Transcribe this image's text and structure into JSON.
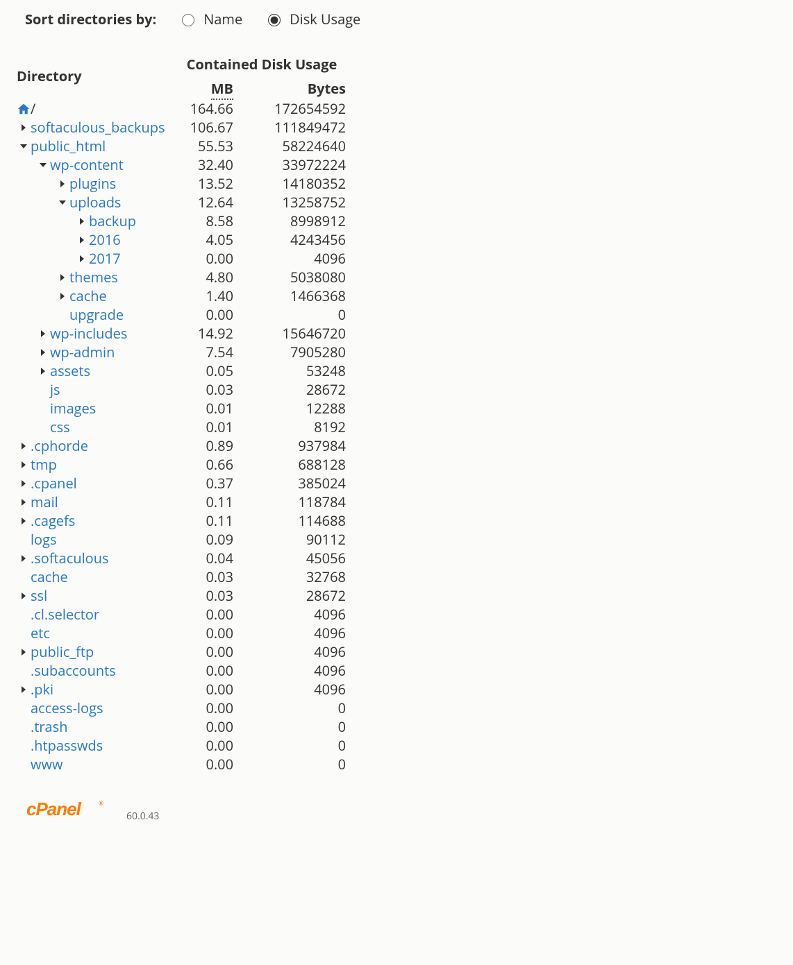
{
  "sort": {
    "label": "Sort directories by:",
    "options": {
      "name": "Name",
      "usage": "Disk Usage"
    },
    "selected": "usage"
  },
  "headers": {
    "directory": "Directory",
    "containedUsage": "Contained Disk Usage",
    "mb": "MB",
    "bytes": "Bytes"
  },
  "rows": [
    {
      "type": "home",
      "indent": 1,
      "mb": "164.66",
      "bytes": "172654592"
    },
    {
      "name": "softaculous_backups",
      "indent": 1,
      "toggle": "closed",
      "mb": "106.67",
      "bytes": "111849472"
    },
    {
      "name": "public_html",
      "indent": 1,
      "toggle": "open",
      "mb": "55.53",
      "bytes": "58224640"
    },
    {
      "name": "wp-content",
      "indent": 2,
      "toggle": "open",
      "mb": "32.40",
      "bytes": "33972224"
    },
    {
      "name": "plugins",
      "indent": 3,
      "toggle": "closed",
      "mb": "13.52",
      "bytes": "14180352"
    },
    {
      "name": "uploads",
      "indent": 3,
      "toggle": "open",
      "mb": "12.64",
      "bytes": "13258752"
    },
    {
      "name": "backup",
      "indent": 4,
      "toggle": "closed",
      "mb": "8.58",
      "bytes": "8998912"
    },
    {
      "name": "2016",
      "indent": 4,
      "toggle": "closed",
      "mb": "4.05",
      "bytes": "4243456"
    },
    {
      "name": "2017",
      "indent": 4,
      "toggle": "closed",
      "mb": "0.00",
      "bytes": "4096"
    },
    {
      "name": "themes",
      "indent": 3,
      "toggle": "closed",
      "mb": "4.80",
      "bytes": "5038080"
    },
    {
      "name": "cache",
      "indent": 3,
      "toggle": "closed",
      "mb": "1.40",
      "bytes": "1466368"
    },
    {
      "name": "upgrade",
      "indent": 3,
      "toggle": "none",
      "mb": "0.00",
      "bytes": "0"
    },
    {
      "name": "wp-includes",
      "indent": 2,
      "toggle": "closed",
      "mb": "14.92",
      "bytes": "15646720"
    },
    {
      "name": "wp-admin",
      "indent": 2,
      "toggle": "closed",
      "mb": "7.54",
      "bytes": "7905280"
    },
    {
      "name": "assets",
      "indent": 2,
      "toggle": "closed",
      "mb": "0.05",
      "bytes": "53248"
    },
    {
      "name": "js",
      "indent": 2,
      "toggle": "none",
      "mb": "0.03",
      "bytes": "28672"
    },
    {
      "name": "images",
      "indent": 2,
      "toggle": "none",
      "mb": "0.01",
      "bytes": "12288"
    },
    {
      "name": "css",
      "indent": 2,
      "toggle": "none",
      "mb": "0.01",
      "bytes": "8192"
    },
    {
      "name": ".cphorde",
      "indent": 1,
      "toggle": "closed",
      "mb": "0.89",
      "bytes": "937984"
    },
    {
      "name": "tmp",
      "indent": 1,
      "toggle": "closed",
      "mb": "0.66",
      "bytes": "688128"
    },
    {
      "name": ".cpanel",
      "indent": 1,
      "toggle": "closed",
      "mb": "0.37",
      "bytes": "385024"
    },
    {
      "name": "mail",
      "indent": 1,
      "toggle": "closed",
      "mb": "0.11",
      "bytes": "118784"
    },
    {
      "name": ".cagefs",
      "indent": 1,
      "toggle": "closed",
      "mb": "0.11",
      "bytes": "114688"
    },
    {
      "name": "logs",
      "indent": 1,
      "toggle": "none",
      "mb": "0.09",
      "bytes": "90112"
    },
    {
      "name": ".softaculous",
      "indent": 1,
      "toggle": "closed",
      "mb": "0.04",
      "bytes": "45056"
    },
    {
      "name": "cache",
      "indent": 1,
      "toggle": "none",
      "mb": "0.03",
      "bytes": "32768"
    },
    {
      "name": "ssl",
      "indent": 1,
      "toggle": "closed",
      "mb": "0.03",
      "bytes": "28672"
    },
    {
      "name": ".cl.selector",
      "indent": 1,
      "toggle": "none",
      "mb": "0.00",
      "bytes": "4096"
    },
    {
      "name": "etc",
      "indent": 1,
      "toggle": "none",
      "mb": "0.00",
      "bytes": "4096"
    },
    {
      "name": "public_ftp",
      "indent": 1,
      "toggle": "closed",
      "mb": "0.00",
      "bytes": "4096"
    },
    {
      "name": ".subaccounts",
      "indent": 1,
      "toggle": "none",
      "mb": "0.00",
      "bytes": "4096"
    },
    {
      "name": ".pki",
      "indent": 1,
      "toggle": "closed",
      "mb": "0.00",
      "bytes": "4096"
    },
    {
      "name": "access-logs",
      "indent": 1,
      "toggle": "none",
      "mb": "0.00",
      "bytes": "0"
    },
    {
      "name": ".trash",
      "indent": 1,
      "toggle": "none",
      "mb": "0.00",
      "bytes": "0"
    },
    {
      "name": ".htpasswds",
      "indent": 1,
      "toggle": "none",
      "mb": "0.00",
      "bytes": "0"
    },
    {
      "name": "www",
      "indent": 1,
      "toggle": "none",
      "mb": "0.00",
      "bytes": "0"
    }
  ],
  "footer": {
    "logo": "cPanel",
    "version": "60.0.43"
  }
}
